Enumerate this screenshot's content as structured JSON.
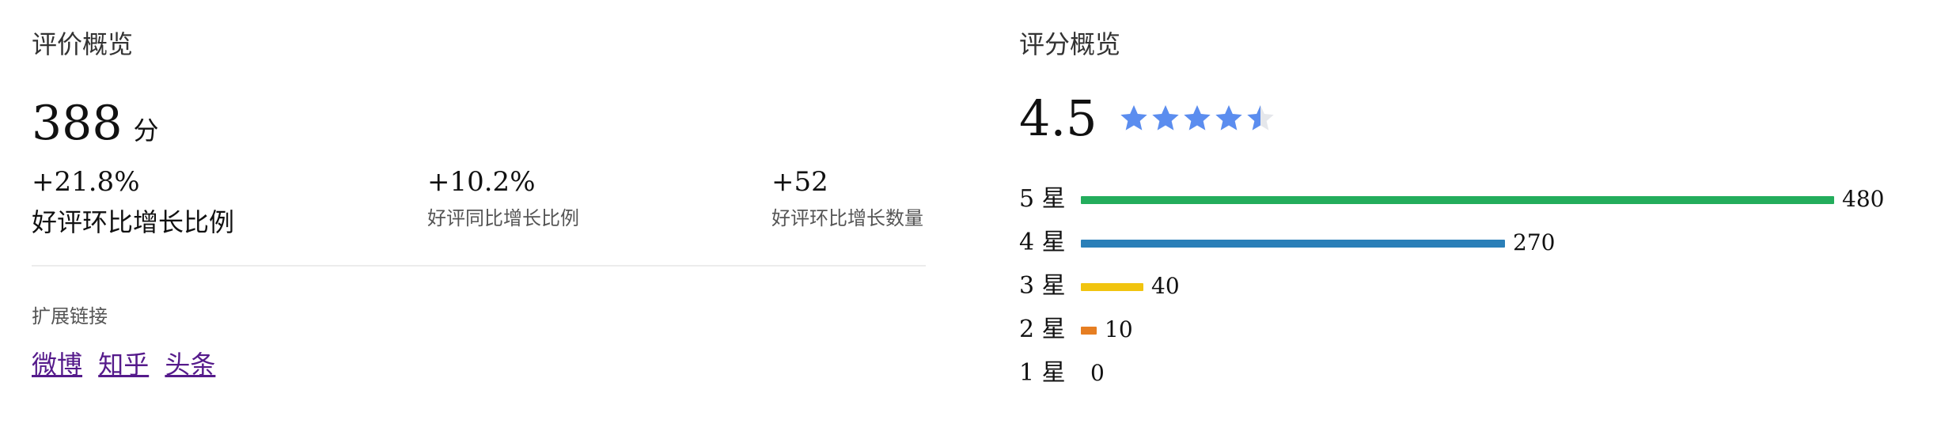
{
  "review_overview": {
    "title": "评价概览",
    "score_value": "388",
    "score_unit": "分",
    "stats": [
      {
        "value": "+21.8%",
        "label": "好评环比增长比例"
      },
      {
        "value": "+10.2%",
        "label": "好评同比增长比例"
      },
      {
        "value": "+52",
        "label": "好评环比增长数量"
      }
    ],
    "links_heading": "扩展链接",
    "links": [
      "微博",
      "知乎",
      "头条"
    ]
  },
  "rating_overview": {
    "title": "评分概览",
    "average": "4.5",
    "average_value": 4.5,
    "max_stars": 5,
    "star_color": "#5b8def",
    "star_empty_color": "#e5e7eb",
    "distribution": [
      {
        "label": "5 星",
        "count": "480",
        "value": 480,
        "color": "#23ad5c"
      },
      {
        "label": "4 星",
        "count": "270",
        "value": 270,
        "color": "#2a7fb8"
      },
      {
        "label": "3 星",
        "count": "40",
        "value": 40,
        "color": "#f1c40f"
      },
      {
        "label": "2 星",
        "count": "10",
        "value": 10,
        "color": "#e67e22"
      },
      {
        "label": "1 星",
        "count": "0",
        "value": 0,
        "color": "#cccccc"
      }
    ]
  }
}
